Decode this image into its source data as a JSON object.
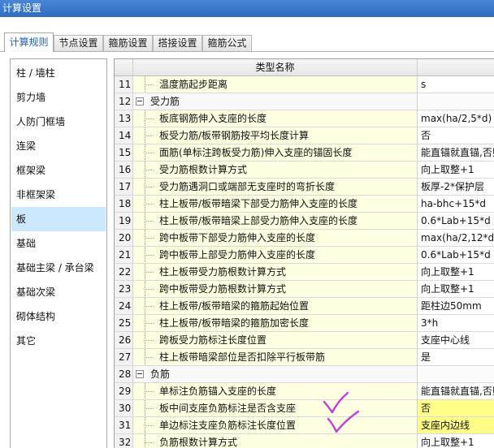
{
  "window": {
    "title": "计算设置"
  },
  "tabs": [
    {
      "label": "计算规则",
      "active": true
    },
    {
      "label": "节点设置",
      "active": false
    },
    {
      "label": "箍筋设置",
      "active": false
    },
    {
      "label": "搭接设置",
      "active": false
    },
    {
      "label": "箍筋公式",
      "active": false
    }
  ],
  "sidebar": {
    "items": [
      "柱 / 墙柱",
      "剪力墙",
      "人防门框墙",
      "连梁",
      "框架梁",
      "非框架梁",
      "板",
      "基础",
      "基础主梁 / 承台梁",
      "基础次梁",
      "砌体结构",
      "其它"
    ],
    "selected_index": 6
  },
  "table": {
    "header": {
      "name": "类型名称"
    },
    "rows": [
      {
        "no": "11",
        "kind": "item",
        "name": "温度筋起步距离",
        "value": "s"
      },
      {
        "no": "12",
        "kind": "group",
        "name": "受力筋"
      },
      {
        "no": "13",
        "kind": "item",
        "name": "板底钢筋伸入支座的长度",
        "value": "max(ha/2,5*d)"
      },
      {
        "no": "14",
        "kind": "item",
        "name": "板受力筋/板带钢筋按平均长度计算",
        "value": "否"
      },
      {
        "no": "15",
        "kind": "item",
        "name": "面筋(单标注跨板受力筋)伸入支座的锚固长度",
        "value": "能直锚就直锚,否则"
      },
      {
        "no": "16",
        "kind": "item",
        "name": "受力筋根数计算方式",
        "value": "向上取整+1"
      },
      {
        "no": "17",
        "kind": "item",
        "name": "受力筋遇洞口或端部无支座时的弯折长度",
        "value": "板厚-2*保护层"
      },
      {
        "no": "18",
        "kind": "item",
        "name": "柱上板带/板带暗梁下部受力筋伸入支座的长度",
        "value": "ha-bhc+15*d"
      },
      {
        "no": "19",
        "kind": "item",
        "name": "柱上板带/板带暗梁上部受力筋伸入支座的长度",
        "value": "0.6*Lab+15*d"
      },
      {
        "no": "20",
        "kind": "item",
        "name": "跨中板带下部受力筋伸入支座的长度",
        "value": "max(ha/2,12*d)"
      },
      {
        "no": "21",
        "kind": "item",
        "name": "跨中板带上部受力筋伸入支座的长度",
        "value": "0.6*Lab+15*d"
      },
      {
        "no": "22",
        "kind": "item",
        "name": "柱上板带受力筋根数计算方式",
        "value": "向上取整+1"
      },
      {
        "no": "23",
        "kind": "item",
        "name": "跨中板带受力筋根数计算方式",
        "value": "向上取整+1"
      },
      {
        "no": "24",
        "kind": "item",
        "name": "柱上板带/板带暗梁的箍筋起始位置",
        "value": "距柱边50mm"
      },
      {
        "no": "25",
        "kind": "item",
        "name": "柱上板带/板带暗梁的箍筋加密长度",
        "value": "3*h"
      },
      {
        "no": "26",
        "kind": "item",
        "name": "跨板受力筋标注长度位置",
        "value": "支座中心线"
      },
      {
        "no": "27",
        "kind": "item",
        "name": "柱上板带暗梁部位是否扣除平行板带筋",
        "value": "是"
      },
      {
        "no": "28",
        "kind": "group",
        "name": "负筋"
      },
      {
        "no": "29",
        "kind": "item",
        "name": "单标注负筋锚入支座的长度",
        "value": "能直锚就直锚,否则"
      },
      {
        "no": "30",
        "kind": "item",
        "name": "板中间支座负筋标注是否含支座",
        "value": "否",
        "highlighted": true
      },
      {
        "no": "31",
        "kind": "item",
        "name": "单边标注支座负筋标注长度位置",
        "value": "支座内边线",
        "highlighted": true
      },
      {
        "no": "32",
        "kind": "item",
        "name": "负筋根数计算方式",
        "value": "向上取整+1"
      }
    ]
  },
  "colors": {
    "accent": "#1c5fb8",
    "title_bar": "#2f6cc0",
    "selected_item": "#cce8ff",
    "name_cell": "#ffffe1",
    "highlight": "#ffff88",
    "annotation_mark": "#c43bd6"
  }
}
